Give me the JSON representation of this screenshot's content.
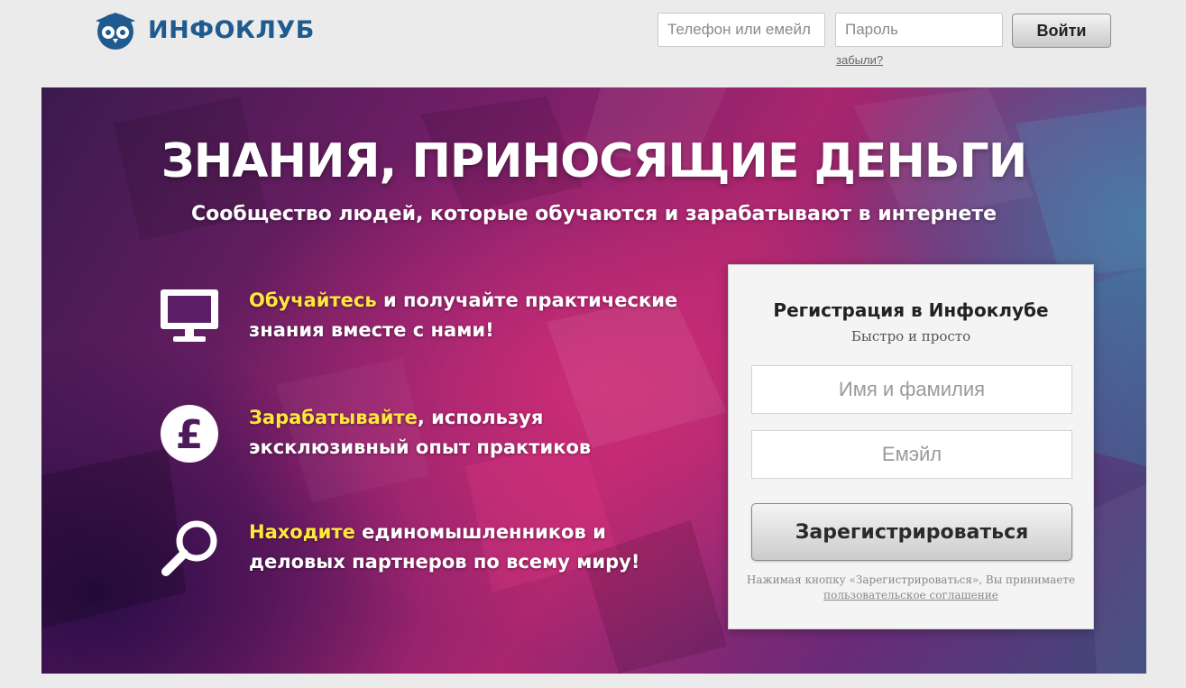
{
  "header": {
    "logo_text": "ИНФОКЛУБ",
    "login_placeholder": "Телефон или емейл",
    "password_placeholder": "Пароль",
    "login_button": "Войти",
    "forgot_link": "забыли?"
  },
  "hero": {
    "title": "ЗНАНИЯ, ПРИНОСЯЩИЕ ДЕНЬГИ",
    "subtitle": "Сообщество людей, которые обучаются и зарабатывают в интернете",
    "features": [
      {
        "icon": "monitor-icon",
        "highlight": "Обучайтесь",
        "rest": " и получайте практические знания вместе с нами!"
      },
      {
        "icon": "pound-coin-icon",
        "highlight": "Зарабатывайте",
        "rest": ", используя эксклюзивный опыт практиков"
      },
      {
        "icon": "magnifier-icon",
        "highlight": "Находите",
        "rest": " единомышленников и деловых партнеров по всему миру!"
      }
    ]
  },
  "registration": {
    "title": "Регистрация в Инфоклубе",
    "subtitle": "Быстро и просто",
    "name_placeholder": "Имя и фамилия",
    "email_placeholder": "Емэйл",
    "submit_button": "Зарегистрироваться",
    "note_text": "Нажимая кнопку «Зарегистрироваться», Вы принимаете",
    "agreement_link": "пользовательское соглашение"
  },
  "colors": {
    "brand": "#1f5b8f",
    "highlight": "#ffe83a"
  }
}
